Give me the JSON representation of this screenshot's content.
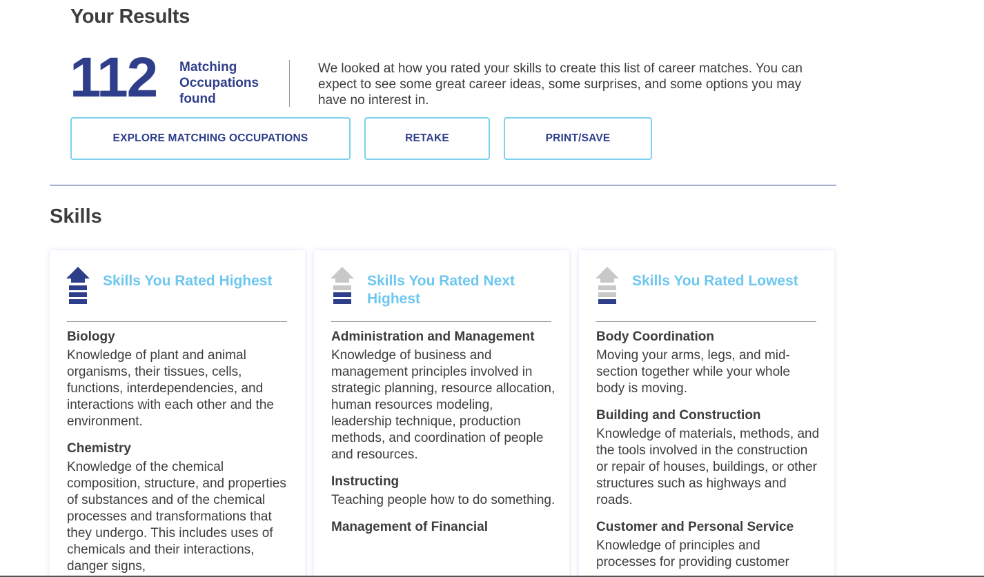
{
  "header": {
    "title": "Your Results"
  },
  "results": {
    "count": "112",
    "count_label": "Matching Occupations found",
    "intro": "We looked at how you rated your skills to create this list of career matches. You can expect to see some great career ideas, some surprises, and some options you may have no interest in."
  },
  "actions": {
    "explore_label": "EXPLORE MATCHING OCCUPATIONS",
    "retake_label": "RETAKE",
    "print_label": "PRINT/SAVE"
  },
  "skills_section": {
    "title": "Skills"
  },
  "cards": [
    {
      "heading": "Skills You Rated Highest",
      "icon": "arrow-level-highest-icon",
      "items": [
        {
          "name": "Biology",
          "desc": "Knowledge of plant and animal organisms, their tissues, cells, functions, interdependencies, and interactions with each other and the environment."
        },
        {
          "name": "Chemistry",
          "desc": "Knowledge of the chemical composition, structure, and properties of substances and of the chemical processes and transformations that they undergo. This includes uses of chemicals and their interactions, danger signs,"
        }
      ]
    },
    {
      "heading": "Skills You Rated Next Highest",
      "icon": "arrow-level-next-highest-icon",
      "items": [
        {
          "name": "Administration and Management",
          "desc": "Knowledge of business and management principles involved in strategic planning, resource allocation, human resources modeling, leadership technique, production methods, and coordination of people and resources."
        },
        {
          "name": "Instructing",
          "desc": "Teaching people how to do something."
        },
        {
          "name": "Management of Financial",
          "desc": ""
        }
      ]
    },
    {
      "heading": "Skills You Rated Lowest",
      "icon": "arrow-level-lowest-icon",
      "items": [
        {
          "name": "Body Coordination",
          "desc": "Moving your arms, legs, and mid-section together while your whole body is moving."
        },
        {
          "name": "Building and Construction",
          "desc": "Knowledge of materials, methods, and the tools involved in the construction or repair of houses, buildings, or other structures such as highways and roads."
        },
        {
          "name": "Customer and Personal Service",
          "desc": "Knowledge of principles and processes for providing customer"
        }
      ]
    }
  ],
  "colors": {
    "brand_navy": "#2f3e8a",
    "accent_blue": "#6dc7ef",
    "button_border": "#7dd0ee",
    "icon_gray": "#c8c8c8"
  }
}
